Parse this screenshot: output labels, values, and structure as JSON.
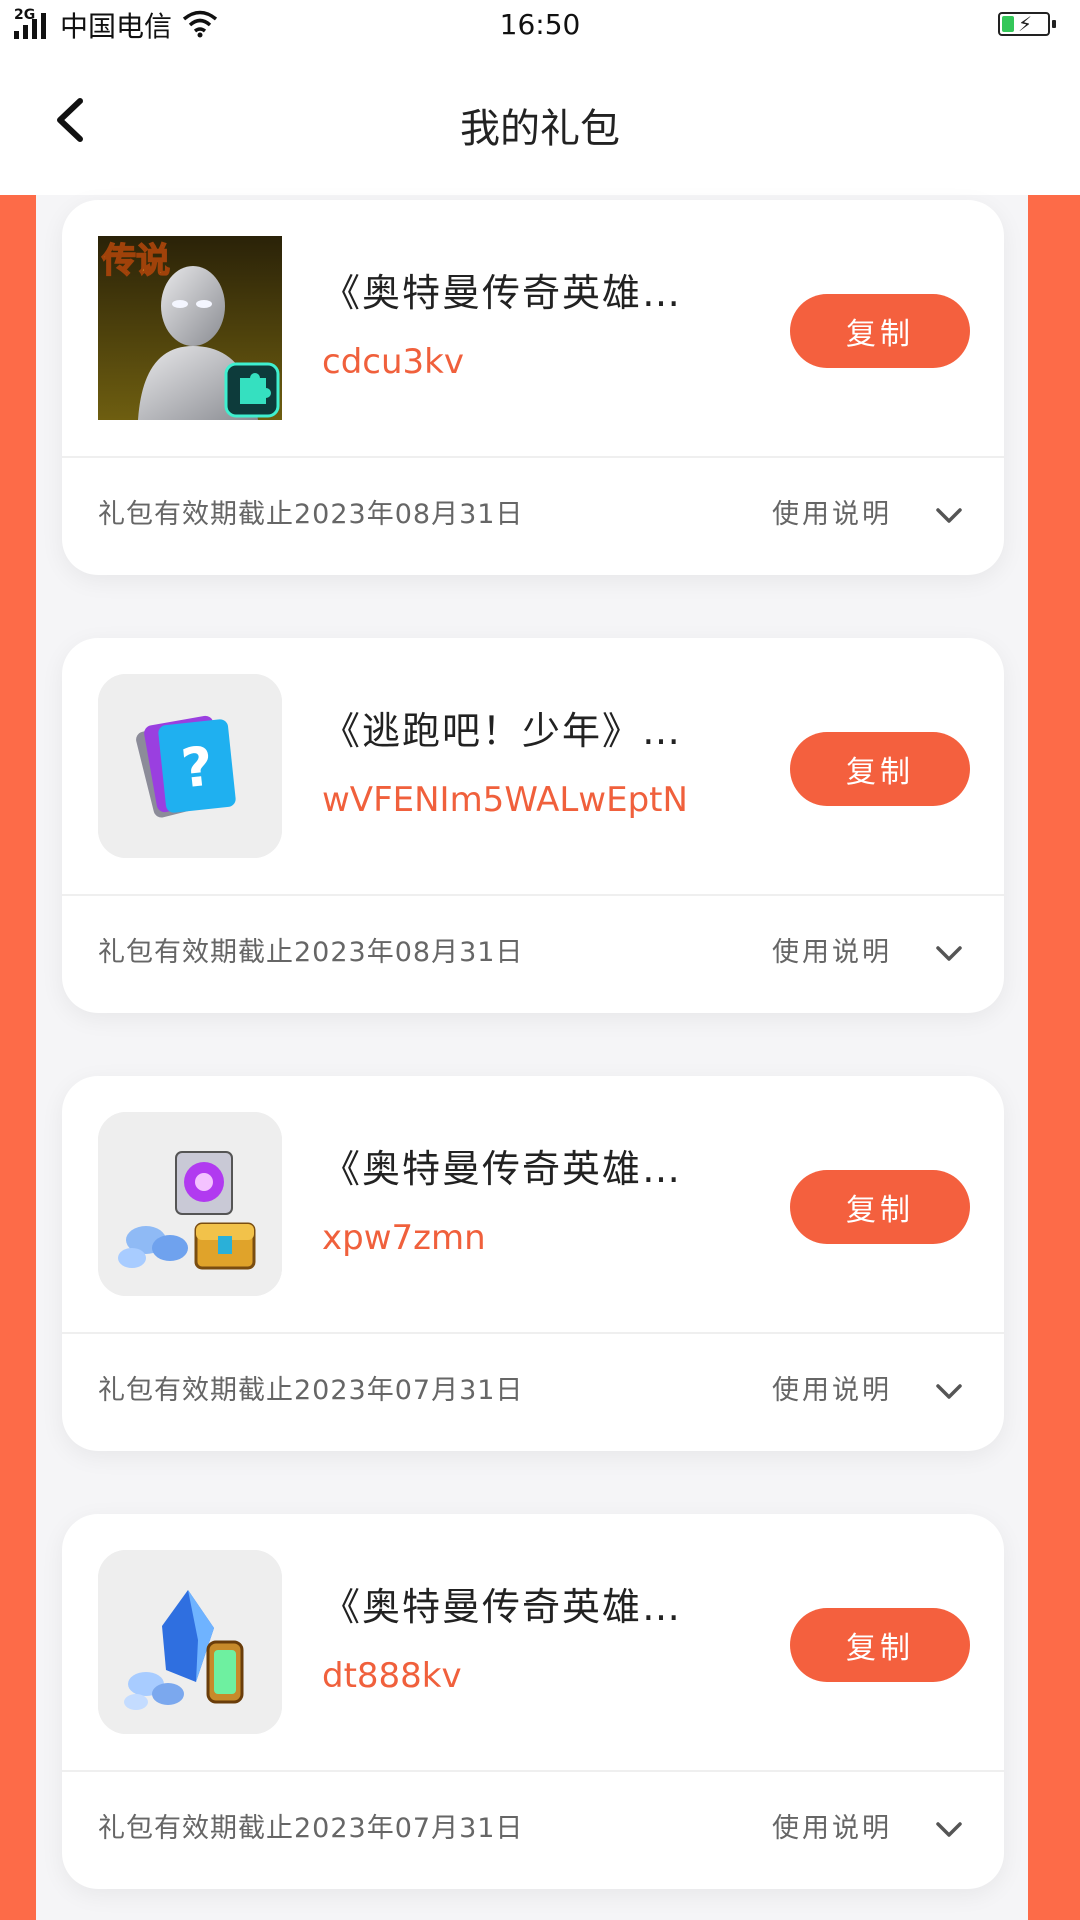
{
  "status_bar": {
    "network": "2G",
    "carrier": "中国电信",
    "time": "16:50"
  },
  "nav": {
    "title": "我的礼包"
  },
  "colors": {
    "accent": "#f4603e",
    "side_background": "#fd6b48"
  },
  "gifts": [
    {
      "title": "《奥特曼传奇英雄…",
      "code": "cdcu3kv",
      "copy_label": "复制",
      "validity": "礼包有效期截止2023年08月31日",
      "instructions_label": "使用说明",
      "icon": "ultraman-legend-icon",
      "icon_text": "传说"
    },
    {
      "title": "《逃跑吧！少年》…",
      "code": "wVFENIm5WALwEptN",
      "copy_label": "复制",
      "validity": "礼包有效期截止2023年08月31日",
      "instructions_label": "使用说明",
      "icon": "mystery-card-icon"
    },
    {
      "title": "《奥特曼传奇英雄…",
      "code": "xpw7zmn",
      "copy_label": "复制",
      "validity": "礼包有效期截止2023年07月31日",
      "instructions_label": "使用说明",
      "icon": "treasure-chest-icon"
    },
    {
      "title": "《奥特曼传奇英雄…",
      "code": "dt888kv",
      "copy_label": "复制",
      "validity": "礼包有效期截止2023年07月31日",
      "instructions_label": "使用说明",
      "icon": "crystal-cylinder-icon"
    }
  ]
}
